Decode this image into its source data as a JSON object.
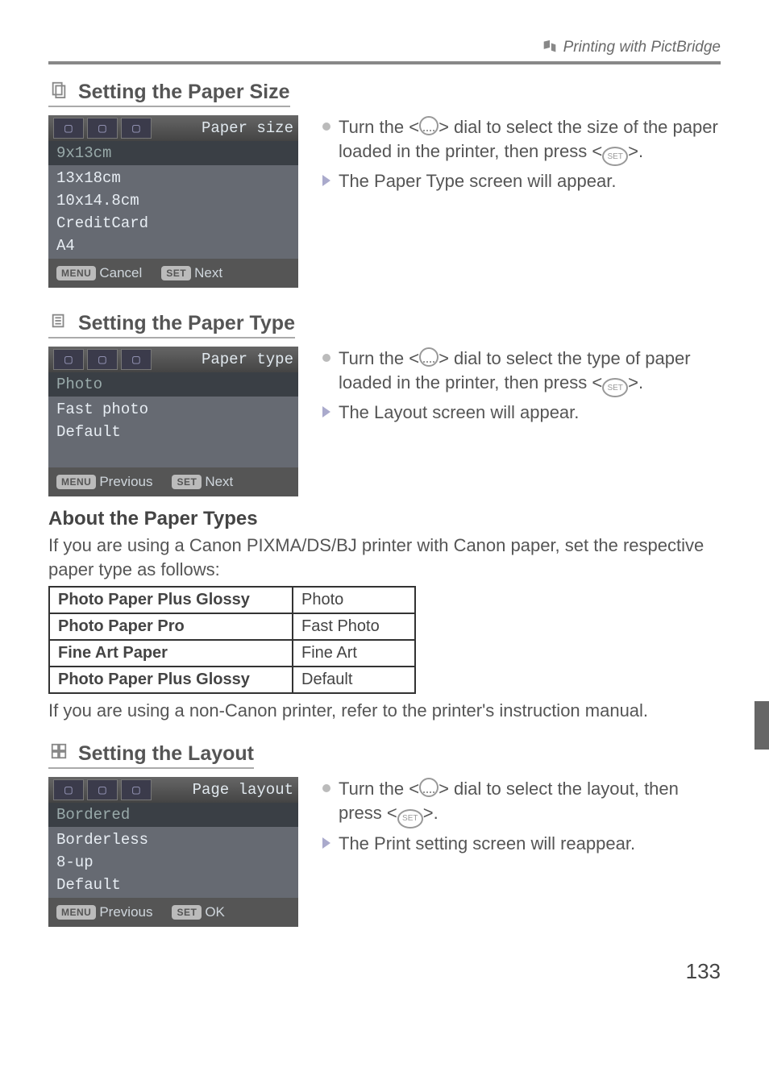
{
  "header": {
    "breadcrumb": "Printing with PictBridge"
  },
  "sizeSection": {
    "heading": "Setting the Paper Size",
    "panel": {
      "title": "Paper size",
      "selected": "9x13cm",
      "items": [
        "13x18cm",
        "10x14.8cm",
        "CreditCard",
        "A4"
      ],
      "leftBtnBadge": "MENU",
      "leftBtnLabel": "Cancel",
      "rightBtnBadge": "SET",
      "rightBtnLabel": "Next"
    },
    "bullet1a": "Turn the <",
    "bullet1b": "> dial to select the size of the paper loaded in the printer, then press <",
    "bullet1c": ">.",
    "bullet2": "The Paper Type screen will appear."
  },
  "typeSection": {
    "heading": "Setting the Paper Type",
    "panel": {
      "title": "Paper type",
      "selected": "Photo",
      "items": [
        "Fast photo",
        "Default"
      ],
      "leftBtnBadge": "MENU",
      "leftBtnLabel": "Previous",
      "rightBtnBadge": "SET",
      "rightBtnLabel": "Next"
    },
    "bullet1a": "Turn the <",
    "bullet1b": "> dial to select the type of paper loaded in the printer, then press <",
    "bullet1c": ">.",
    "bullet2": "The Layout screen will appear."
  },
  "about": {
    "heading": "About the Paper Types",
    "intro": "If you are using a Canon PIXMA/DS/BJ printer with Canon paper, set the respective paper type as follows:",
    "rows": [
      {
        "h": "Photo Paper Plus Glossy",
        "v": "Photo"
      },
      {
        "h": "Photo Paper Pro",
        "v": "Fast Photo"
      },
      {
        "h": "Fine Art Paper",
        "v": "Fine Art"
      },
      {
        "h": "Photo Paper Plus Glossy",
        "v": "Default"
      }
    ],
    "outro": "If you are using a non-Canon printer, refer to the printer's instruction manual."
  },
  "layoutSection": {
    "heading": "Setting the Layout",
    "panel": {
      "title": "Page layout",
      "selected": "Bordered",
      "items": [
        "Borderless",
        "8-up",
        "Default"
      ],
      "leftBtnBadge": "MENU",
      "leftBtnLabel": "Previous",
      "rightBtnBadge": "SET",
      "rightBtnLabel": "OK"
    },
    "bullet1a": "Turn the <",
    "bullet1b": "> dial to select the layout, then press <",
    "bullet1c": ">.",
    "bullet2": "The Print setting screen will reappear."
  },
  "setLabel": "SET",
  "pageNumber": "133"
}
